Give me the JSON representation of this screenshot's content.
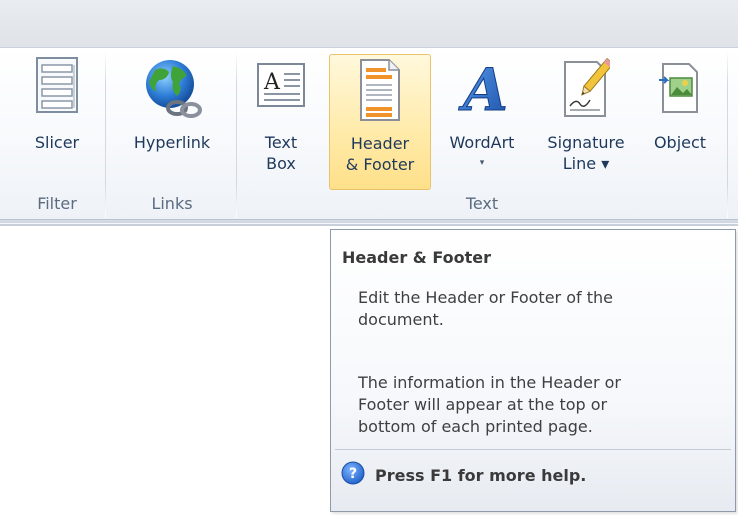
{
  "ribbon": {
    "groups": [
      {
        "label": "Filter"
      },
      {
        "label": "Links"
      },
      {
        "label": "Text"
      }
    ],
    "buttons": {
      "slicer": {
        "line1": "Slicer"
      },
      "hyperlink": {
        "line1": "Hyperlink"
      },
      "textbox": {
        "line1": "Text",
        "line2": "Box"
      },
      "header_footer": {
        "line1": "Header",
        "line2": "& Footer"
      },
      "wordart": {
        "line1": "WordArt",
        "line2": "▾"
      },
      "signature": {
        "line1": "Signature",
        "line2": "Line ▾"
      },
      "object": {
        "line1": "Object"
      }
    }
  },
  "tooltip": {
    "title": "Header & Footer",
    "para1_line1": "Edit the Header or Footer of the",
    "para1_line2": "document.",
    "para2_line1": "The information in the Header or",
    "para2_line2": "Footer will appear at the top or",
    "para2_line3": "bottom of each printed page.",
    "help": "Press F1 for more help."
  }
}
